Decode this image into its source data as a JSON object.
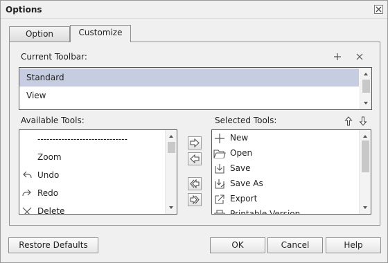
{
  "dialog": {
    "title": "Options"
  },
  "tabs": [
    {
      "label": "Option"
    },
    {
      "label": "Customize"
    }
  ],
  "current_toolbar": {
    "label": "Current Toolbar:",
    "items": [
      {
        "label": "Standard"
      },
      {
        "label": "View"
      }
    ],
    "selected": "Standard"
  },
  "available_tools": {
    "label": "Available Tools:",
    "items": [
      {
        "label": "------------------------------",
        "icon": ""
      },
      {
        "label": "Zoom",
        "icon": ""
      },
      {
        "label": "Undo",
        "icon": "undo-icon"
      },
      {
        "label": "Redo",
        "icon": "redo-icon"
      },
      {
        "label": "Delete",
        "icon": "delete-icon"
      }
    ]
  },
  "selected_tools": {
    "label": "Selected Tools:",
    "items": [
      {
        "label": "New",
        "icon": "new-icon"
      },
      {
        "label": "Open",
        "icon": "open-folder-icon"
      },
      {
        "label": "Save",
        "icon": "save-icon"
      },
      {
        "label": "Save As",
        "icon": "save-as-icon"
      },
      {
        "label": "Export",
        "icon": "export-icon"
      },
      {
        "label": "Printable Version",
        "icon": "printer-icon"
      }
    ]
  },
  "buttons": {
    "restore_defaults": "Restore Defaults",
    "ok": "OK",
    "cancel": "Cancel",
    "help": "Help"
  },
  "colors": {
    "selection": "#c6cde0",
    "dialog_bg": "#f0f0f0",
    "border": "#8f8f8f"
  }
}
